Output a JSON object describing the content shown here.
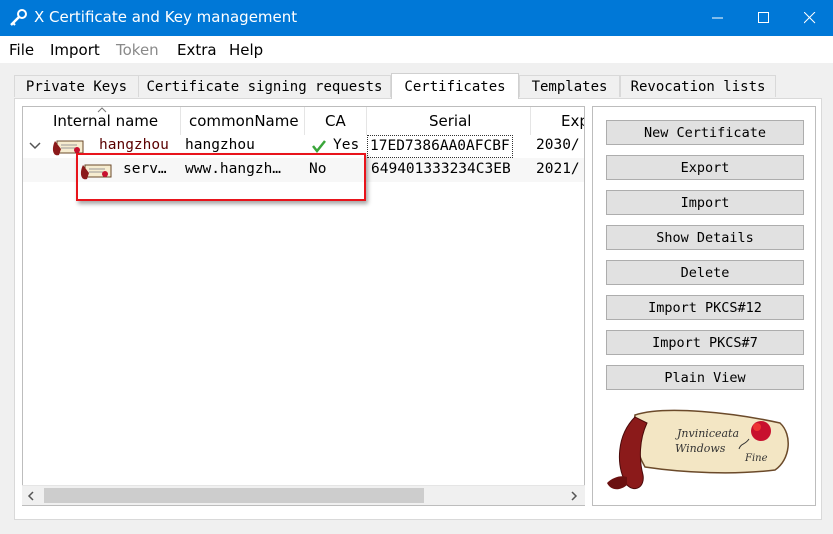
{
  "window": {
    "title": "X Certificate and Key management"
  },
  "menu": [
    "File",
    "Import",
    "Token",
    "Extra",
    "Help"
  ],
  "tabs": [
    "Private Keys",
    "Certificate signing requests",
    "Certificates",
    "Templates",
    "Revocation lists"
  ],
  "active_tab": "Certificates",
  "tree": {
    "columns": [
      "Internal name",
      "commonName",
      "CA",
      "Serial",
      "Exp"
    ],
    "rows": [
      {
        "internal_name": "hangzhou",
        "common_name": "hangzhou",
        "ca": "Yes",
        "serial": "17ED7386AA0AFCBF",
        "expiry": "2030/"
      },
      {
        "internal_name": "serv…",
        "common_name": "www.hangzh…",
        "ca": "No",
        "serial": "649401333234C3EB",
        "expiry": "2021/"
      }
    ]
  },
  "buttons": [
    "New Certificate",
    "Export",
    "Import",
    "Show Details",
    "Delete",
    "Import PKCS#12",
    "Import PKCS#7",
    "Plain View"
  ],
  "logo_text": [
    "Jnviniceata",
    "Windows",
    "Fine"
  ],
  "colors": {
    "titlebar": "#0078d7",
    "highlight_box": "#e8141b",
    "check": "#3aa53a"
  },
  "icons": {
    "app": "key-icon",
    "certificate": "certificate-icon",
    "ca_check": "checkmark-icon"
  }
}
